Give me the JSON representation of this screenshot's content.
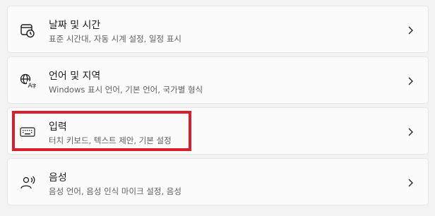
{
  "settings": {
    "items": [
      {
        "icon": "calendar-clock-icon",
        "title": "날짜 및 시간",
        "subtitle": "표준 시간대, 자동 시계 설정, 일정 표시"
      },
      {
        "icon": "language-globe-icon",
        "title": "언어 및 지역",
        "subtitle": "Windows 표시 언어, 기본 언어, 국가별 형식"
      },
      {
        "icon": "keyboard-icon",
        "title": "입력",
        "subtitle": "터치 키보드, 텍스트 제안, 기본 설정"
      },
      {
        "icon": "speech-person-icon",
        "title": "음성",
        "subtitle": "음성 언어, 음성 인식 마이크 설정, 음성"
      }
    ]
  },
  "annotation": {
    "highlight_color": "#d7202c"
  }
}
